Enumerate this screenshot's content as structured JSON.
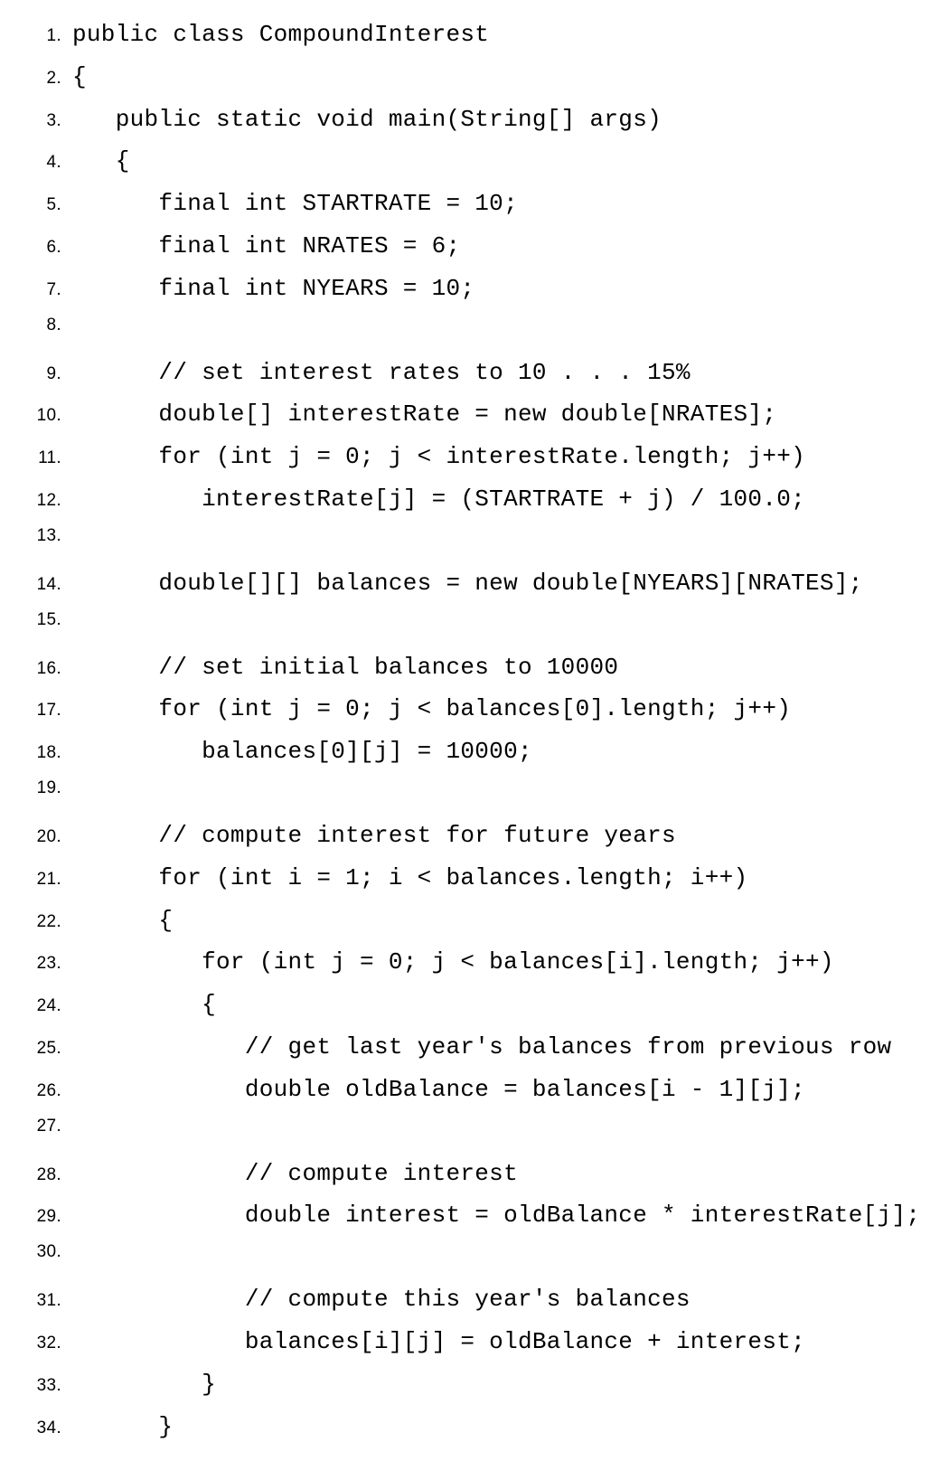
{
  "lines": [
    {
      "num": "1.",
      "code": "public class CompoundInterest"
    },
    {
      "num": "2.",
      "code": "{"
    },
    {
      "num": "3.",
      "code": "   public static void main(String[] args)"
    },
    {
      "num": "4.",
      "code": "   {"
    },
    {
      "num": "5.",
      "code": "      final int STARTRATE = 10;"
    },
    {
      "num": "6.",
      "code": "      final int NRATES = 6;"
    },
    {
      "num": "7.",
      "code": "      final int NYEARS = 10;"
    },
    {
      "num": "8.",
      "code": ""
    },
    {
      "num": "9.",
      "code": "      // set interest rates to 10 . . . 15%"
    },
    {
      "num": "10.",
      "code": "      double[] interestRate = new double[NRATES];"
    },
    {
      "num": "11.",
      "code": "      for (int j = 0; j < interestRate.length; j++)"
    },
    {
      "num": "12.",
      "code": "         interestRate[j] = (STARTRATE + j) / 100.0;"
    },
    {
      "num": "13.",
      "code": ""
    },
    {
      "num": "14.",
      "code": "      double[][] balances = new double[NYEARS][NRATES];"
    },
    {
      "num": "15.",
      "code": ""
    },
    {
      "num": "16.",
      "code": "      // set initial balances to 10000"
    },
    {
      "num": "17.",
      "code": "      for (int j = 0; j < balances[0].length; j++)"
    },
    {
      "num": "18.",
      "code": "         balances[0][j] = 10000;"
    },
    {
      "num": "19.",
      "code": ""
    },
    {
      "num": "20.",
      "code": "      // compute interest for future years"
    },
    {
      "num": "21.",
      "code": "      for (int i = 1; i < balances.length; i++)"
    },
    {
      "num": "22.",
      "code": "      {"
    },
    {
      "num": "23.",
      "code": "         for (int j = 0; j < balances[i].length; j++)"
    },
    {
      "num": "24.",
      "code": "         {"
    },
    {
      "num": "25.",
      "code": "            // get last year's balances from previous row"
    },
    {
      "num": "26.",
      "code": "            double oldBalance = balances[i - 1][j];"
    },
    {
      "num": "27.",
      "code": ""
    },
    {
      "num": "28.",
      "code": "            // compute interest"
    },
    {
      "num": "29.",
      "code": "            double interest = oldBalance * interestRate[j];"
    },
    {
      "num": "30.",
      "code": ""
    },
    {
      "num": "31.",
      "code": "            // compute this year's balances"
    },
    {
      "num": "32.",
      "code": "            balances[i][j] = oldBalance + interest;"
    },
    {
      "num": "33.",
      "code": "         }"
    },
    {
      "num": "34.",
      "code": "      }"
    }
  ]
}
